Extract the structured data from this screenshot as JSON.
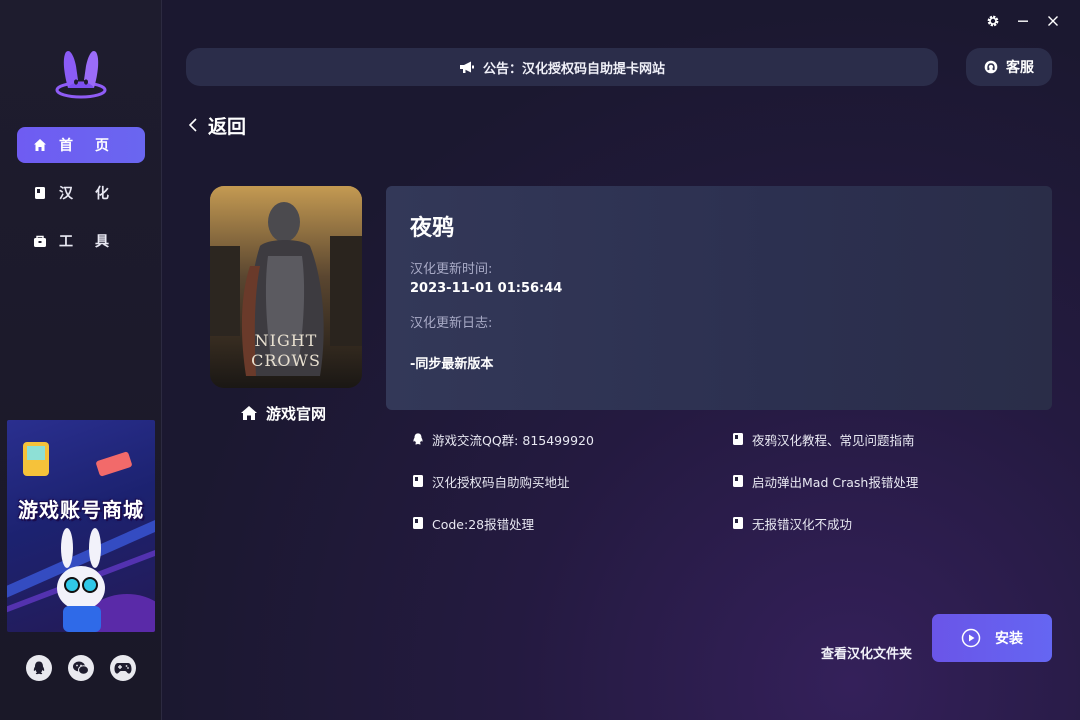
{
  "sidebar": {
    "logo_icon": "rabbit-logo-icon",
    "items": [
      {
        "label": "首页",
        "icon": "home-icon",
        "active": true
      },
      {
        "label": "汉化",
        "icon": "book-icon",
        "active": false
      },
      {
        "label": "工具",
        "icon": "toolbox-icon",
        "active": false
      }
    ],
    "banner": {
      "title": "游戏账号商城"
    },
    "social": [
      "qq-icon",
      "wechat-icon",
      "gamepad-icon"
    ]
  },
  "window_controls": [
    "gear-icon",
    "minimize-icon",
    "close-icon"
  ],
  "header": {
    "announcement": "公告：汉化授权码自助提卡网站",
    "service_label": "客服"
  },
  "back_label": "返回",
  "game": {
    "title": "夜鸦",
    "cover_text": "NIGHT CROWS",
    "official_site_label": "游戏官网",
    "update_time_label": "汉化更新时间:",
    "update_time": "2023-11-01 01:56:44",
    "update_log_label": "汉化更新日志:",
    "update_log": "-同步最新版本"
  },
  "links": {
    "left": [
      {
        "label": "游戏交流QQ群: 815499920",
        "icon": "qq-icon"
      },
      {
        "label": "汉化授权码自助购买地址",
        "icon": "doc-icon"
      },
      {
        "label": "Code:28报错处理",
        "icon": "doc-icon"
      }
    ],
    "right": [
      {
        "label": "夜鸦汉化教程、常见问题指南",
        "icon": "doc-icon"
      },
      {
        "label": "启动弹出Mad Crash报错处理",
        "icon": "doc-icon"
      },
      {
        "label": "无报错汉化不成功",
        "icon": "doc-icon"
      }
    ]
  },
  "actions": {
    "open_folder_label": "查看汉化文件夹",
    "install_label": "安装"
  },
  "colors": {
    "accent": "#6a5cf0",
    "sidebar_bg": "#1e1c2e",
    "card_bg": "#2f3352"
  }
}
